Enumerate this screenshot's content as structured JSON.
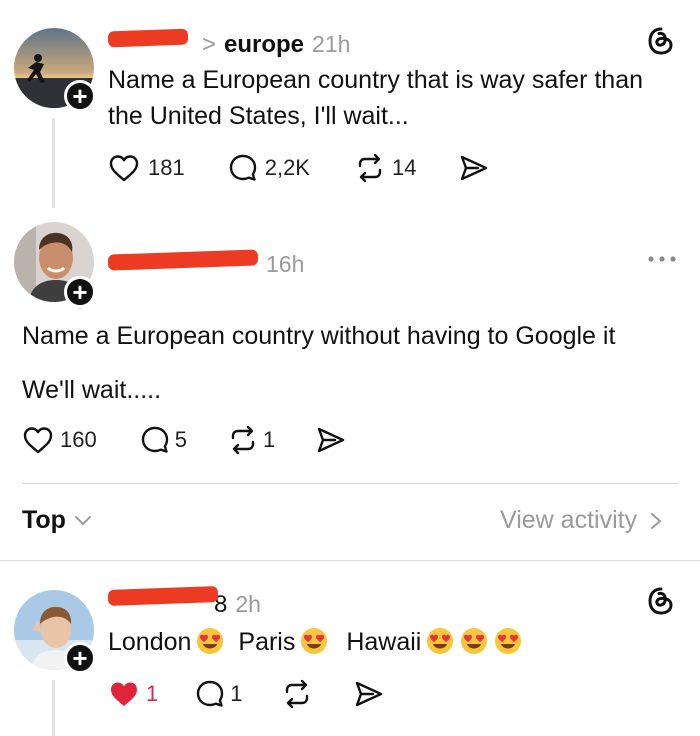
{
  "post1": {
    "breadcrumb_sep": ">",
    "topic": "europe",
    "time": "21h",
    "text_line1": "Name a European country that is way safer than",
    "text_line2": "the United States, I'll wait...",
    "likes": "181",
    "replies": "2,2K",
    "reposts": "14"
  },
  "post2": {
    "time": "16h",
    "text_line1": "Name a European country without having to Google it",
    "text_line2": "We'll wait.....",
    "likes": "160",
    "replies": "5",
    "reposts": "1"
  },
  "sort_bar": {
    "label": "Top",
    "activity_link": "View activity"
  },
  "reply1": {
    "time_suffix": "8",
    "time": "2h",
    "words": [
      "London",
      "Paris",
      "Hawaii"
    ],
    "likes": "1",
    "replies": "1"
  },
  "colors": {
    "redaction": "#ec3b22",
    "like_active": "#ff3040",
    "text": "#101010",
    "muted": "#9a9a9a"
  }
}
